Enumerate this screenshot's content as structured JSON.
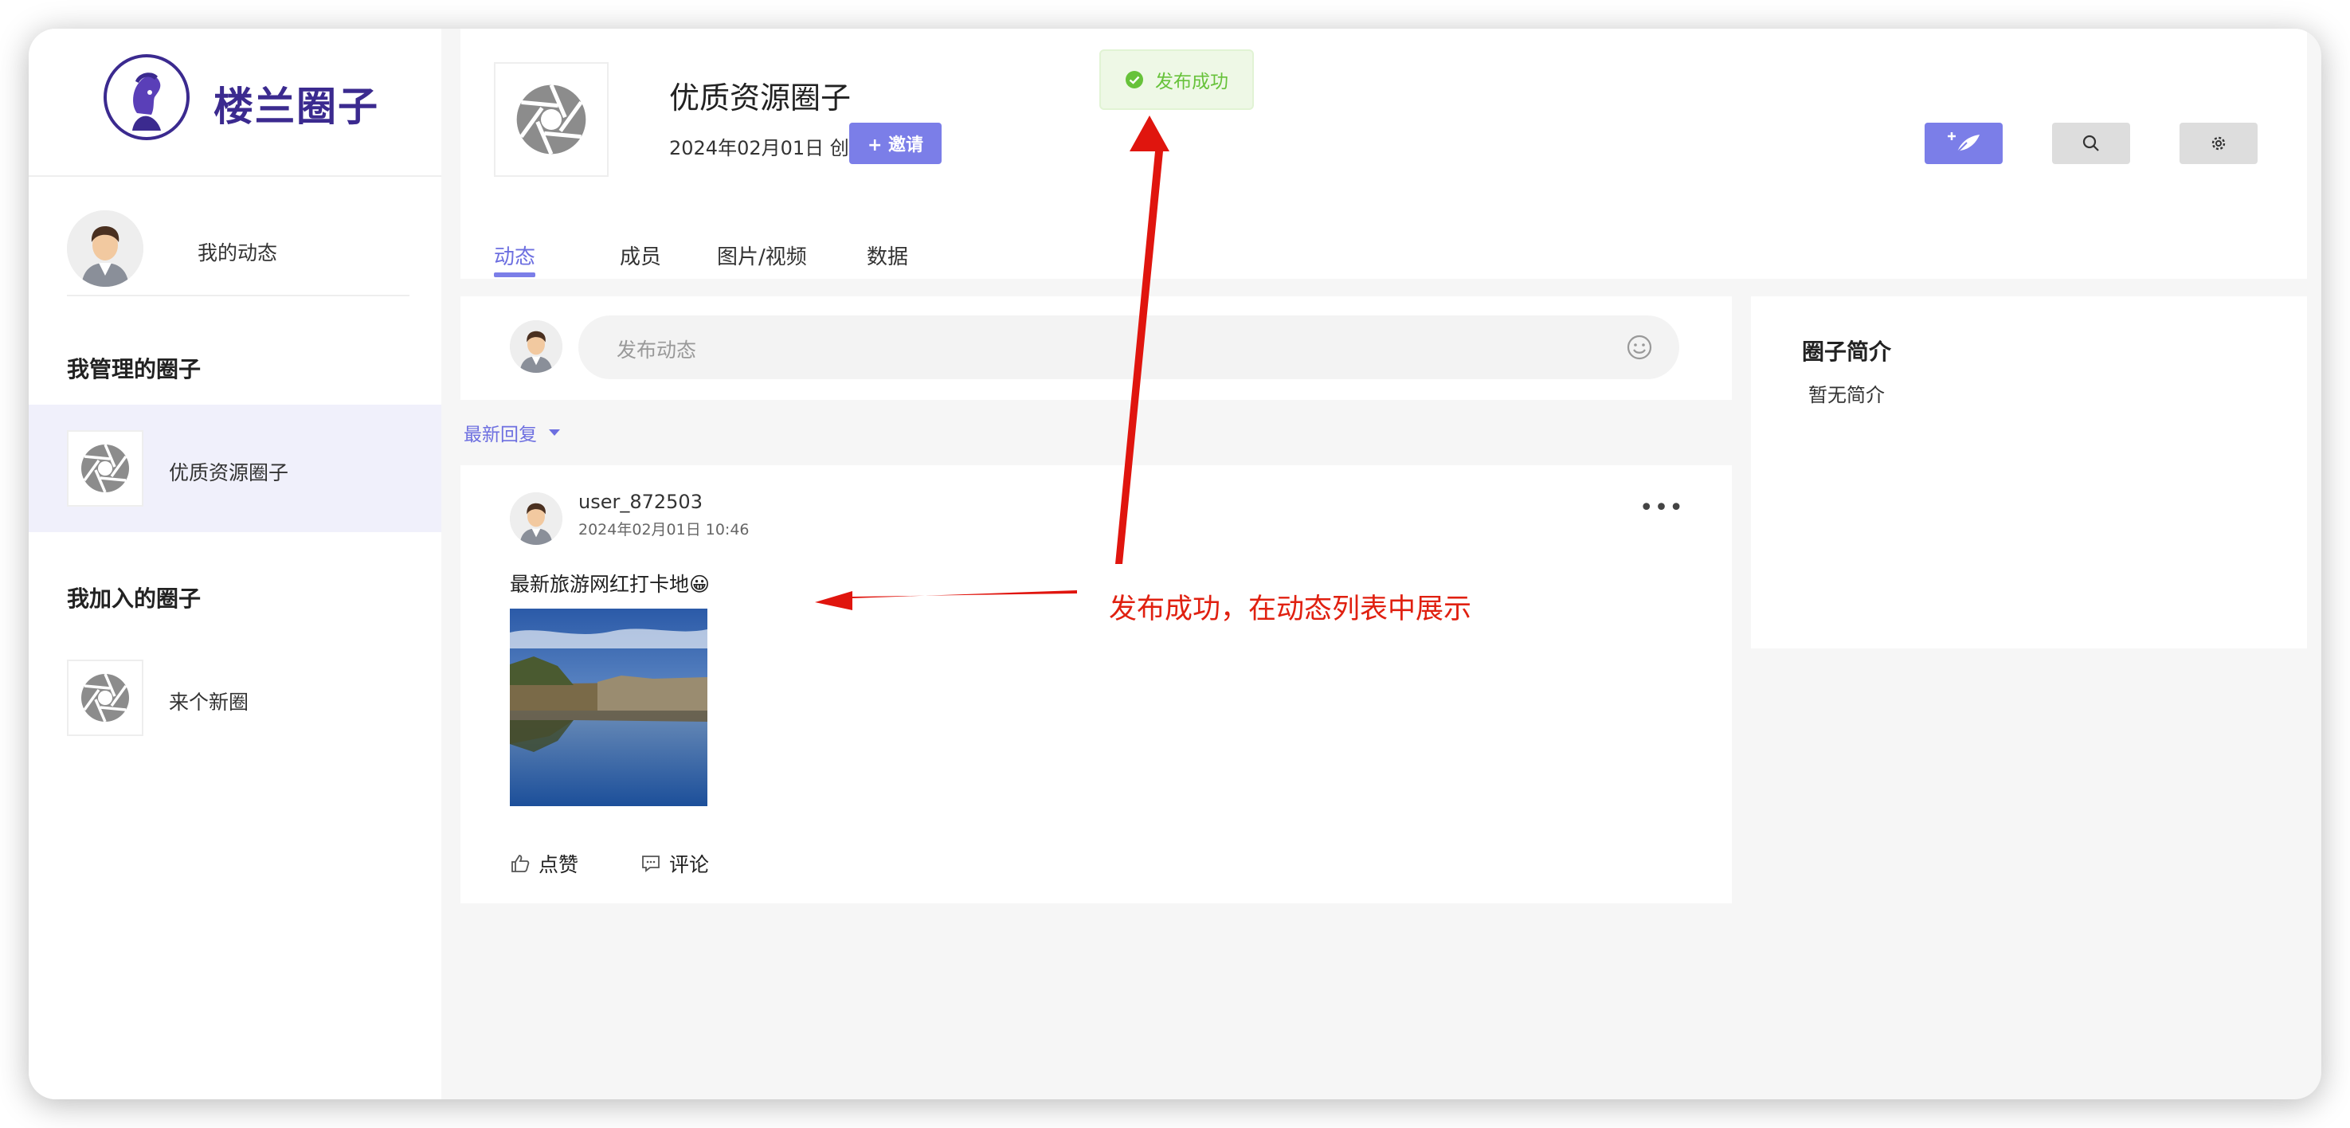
{
  "brand": {
    "name": "楼兰圈子"
  },
  "sidebar": {
    "my_dynamic": "我的动态",
    "managed_title": "我管理的圈子",
    "managed_items": [
      {
        "label": "优质资源圈子"
      }
    ],
    "joined_title": "我加入的圈子",
    "joined_items": [
      {
        "label": "来个新圈"
      }
    ]
  },
  "header": {
    "title": "优质资源圈子",
    "created": "2024年02月01日 创建",
    "invite_label": "+ 邀请",
    "tabs": [
      {
        "label": "动态"
      },
      {
        "label": "成员"
      },
      {
        "label": "图片/视频"
      },
      {
        "label": "数据"
      }
    ]
  },
  "toast": {
    "message": "发布成功",
    "color": "#67c23a"
  },
  "composer": {
    "placeholder": "发布动态"
  },
  "sort": {
    "label": "最新回复"
  },
  "post": {
    "user": "user_872503",
    "time": "2024年02月01日 10:46",
    "text": "最新旅游网红打卡地😀",
    "like_label": "点赞",
    "comment_label": "评论",
    "more": "•••"
  },
  "intro": {
    "title": "圈子简介",
    "text": "暂无简介"
  },
  "annotation": {
    "text": "发布成功，在动态列表中展示",
    "color": "#e02010"
  },
  "colors": {
    "accent": "#7b7ee8",
    "brand": "#3b2a8f"
  }
}
